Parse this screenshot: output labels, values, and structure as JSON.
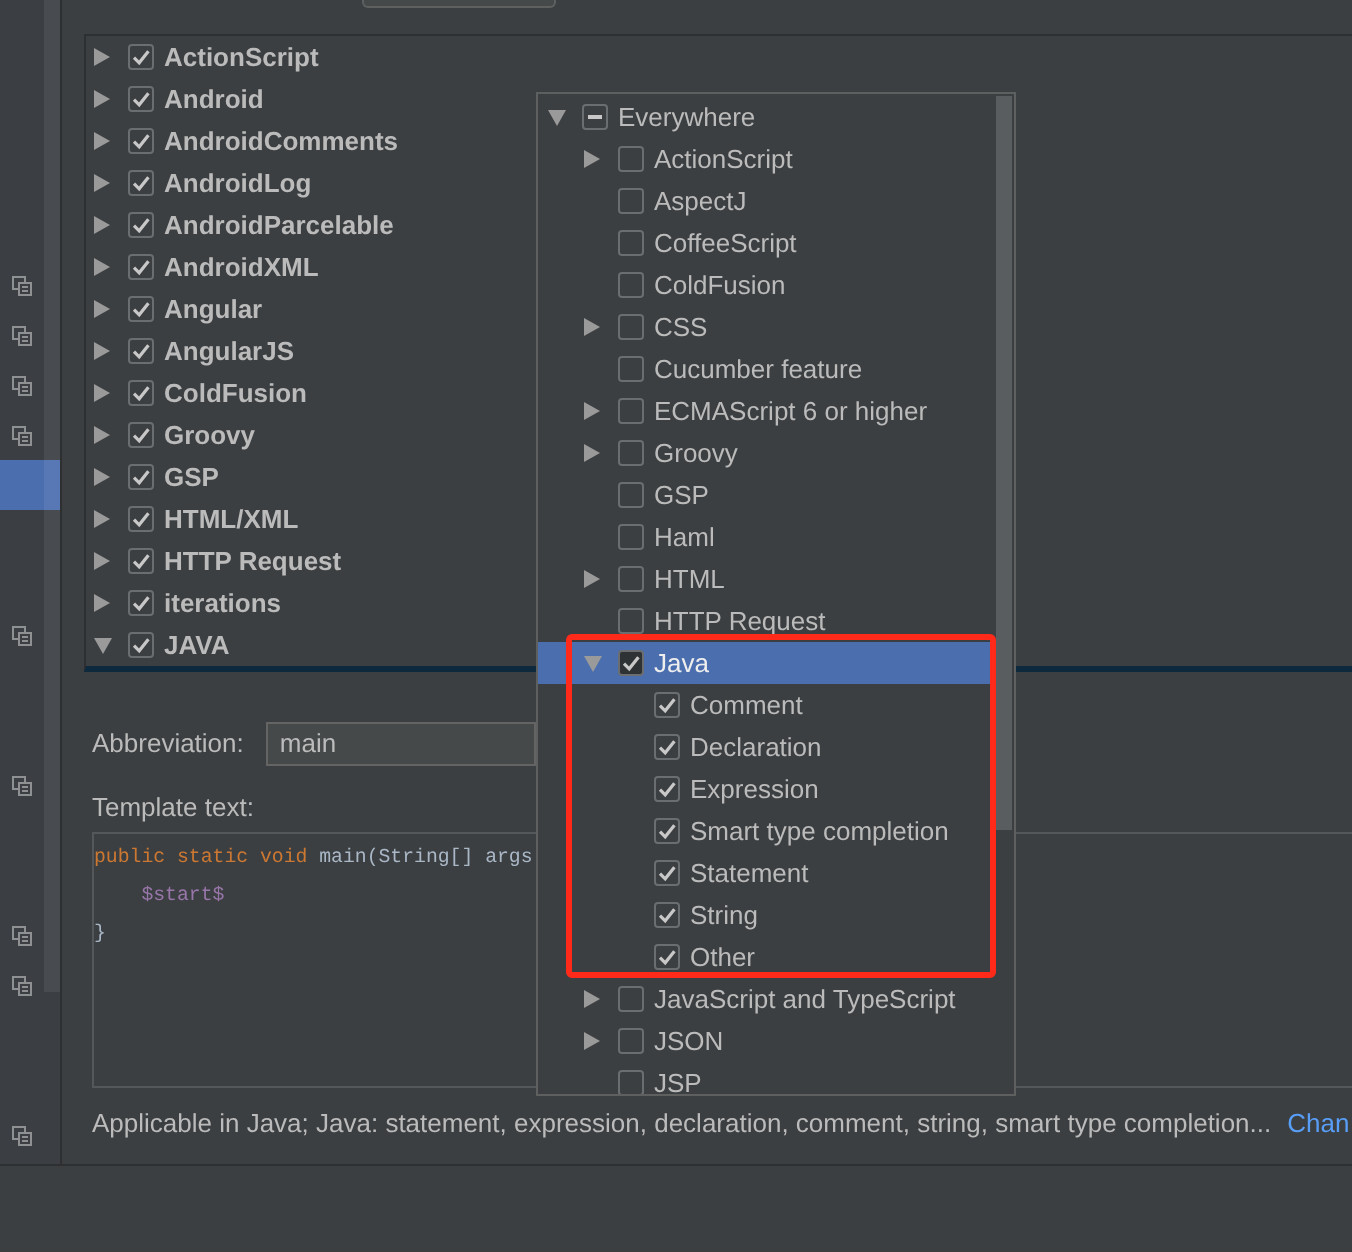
{
  "sidebar": {
    "rows": [
      {
        "icon": true,
        "selected": false
      },
      {
        "icon": true,
        "selected": false
      },
      {
        "icon": true,
        "selected": false
      },
      {
        "icon": true,
        "selected": false
      },
      {
        "icon": false,
        "selected": true
      },
      {
        "icon": false,
        "selected": false
      },
      {
        "icon": false,
        "selected": false
      },
      {
        "icon": true,
        "selected": false
      },
      {
        "icon": false,
        "selected": false
      },
      {
        "icon": false,
        "selected": false
      },
      {
        "icon": true,
        "selected": false
      },
      {
        "icon": false,
        "selected": false
      },
      {
        "icon": false,
        "selected": false
      },
      {
        "icon": true,
        "selected": false
      },
      {
        "icon": true,
        "selected": false
      },
      {
        "icon": false,
        "selected": false
      },
      {
        "icon": false,
        "selected": false
      },
      {
        "icon": true,
        "selected": false
      }
    ]
  },
  "templates": [
    {
      "label": "ActionScript",
      "checked": true,
      "expanded": false
    },
    {
      "label": "Android",
      "checked": true,
      "expanded": false
    },
    {
      "label": "AndroidComments",
      "checked": true,
      "expanded": false
    },
    {
      "label": "AndroidLog",
      "checked": true,
      "expanded": false
    },
    {
      "label": "AndroidParcelable",
      "checked": true,
      "expanded": false
    },
    {
      "label": "AndroidXML",
      "checked": true,
      "expanded": false
    },
    {
      "label": "Angular",
      "checked": true,
      "expanded": false
    },
    {
      "label": "AngularJS",
      "checked": true,
      "expanded": false
    },
    {
      "label": "ColdFusion",
      "checked": true,
      "expanded": false
    },
    {
      "label": "Groovy",
      "checked": true,
      "expanded": false
    },
    {
      "label": "GSP",
      "checked": true,
      "expanded": false
    },
    {
      "label": "HTML/XML",
      "checked": true,
      "expanded": false
    },
    {
      "label": "HTTP Request",
      "checked": true,
      "expanded": false
    },
    {
      "label": "iterations",
      "checked": true,
      "expanded": false
    },
    {
      "label": "JAVA",
      "checked": true,
      "expanded": true
    }
  ],
  "abbreviation": {
    "label": "Abbreviation:",
    "value": "main"
  },
  "template_text": {
    "label": "Template text:",
    "lines": [
      {
        "indented": false,
        "tokens": [
          {
            "text": "public",
            "kind": "keyword"
          },
          {
            "text": "static",
            "kind": "keyword"
          },
          {
            "text": "void",
            "kind": "keyword"
          },
          {
            "text": "main(String[] args",
            "kind": "plain"
          }
        ]
      },
      {
        "indented": true,
        "tokens": [
          {
            "text": "$start$",
            "kind": "variable"
          }
        ]
      },
      {
        "indented": false,
        "tokens": [
          {
            "text": "}",
            "kind": "plain"
          }
        ]
      }
    ]
  },
  "applicable": {
    "text": "Applicable in Java; Java: statement, expression, declaration, comment, string, smart type completion...",
    "link": "Chan"
  },
  "popup": {
    "items": [
      {
        "label": "Everywhere",
        "indeterminate": true,
        "expanded": true,
        "selected": false,
        "children": [
          {
            "label": "ActionScript",
            "checked": false,
            "expanded": false,
            "selected": false,
            "outlined": false
          },
          {
            "label": "AspectJ",
            "checked": false,
            "selected": false,
            "outlined": false
          },
          {
            "label": "CoffeeScript",
            "checked": false,
            "selected": false,
            "outlined": false
          },
          {
            "label": "ColdFusion",
            "checked": false,
            "selected": false,
            "outlined": false
          },
          {
            "label": "CSS",
            "checked": false,
            "expanded": false,
            "selected": false,
            "outlined": false
          },
          {
            "label": "Cucumber feature",
            "checked": false,
            "selected": false,
            "outlined": false
          },
          {
            "label": "ECMAScript 6 or higher",
            "checked": false,
            "expanded": false,
            "selected": false,
            "outlined": false
          },
          {
            "label": "Groovy",
            "checked": false,
            "expanded": false,
            "selected": false,
            "outlined": false
          },
          {
            "label": "GSP",
            "checked": false,
            "selected": false,
            "outlined": false
          },
          {
            "label": "Haml",
            "checked": false,
            "selected": false,
            "outlined": false
          },
          {
            "label": "HTML",
            "checked": false,
            "expanded": false,
            "selected": false,
            "outlined": false
          },
          {
            "label": "HTTP Request",
            "checked": false,
            "selected": false,
            "outlined": false
          },
          {
            "label": "Java",
            "checked": true,
            "expanded": true,
            "selected": true,
            "outlined": true,
            "children": [
              {
                "label": "Comment",
                "checked": true,
                "selected": false
              },
              {
                "label": "Declaration",
                "checked": true,
                "selected": false
              },
              {
                "label": "Expression",
                "checked": true,
                "selected": false
              },
              {
                "label": "Smart type completion",
                "checked": true,
                "selected": false
              },
              {
                "label": "Statement",
                "checked": true,
                "selected": false
              },
              {
                "label": "String",
                "checked": true,
                "selected": false
              },
              {
                "label": "Other",
                "checked": true,
                "selected": false
              }
            ]
          },
          {
            "label": "JavaScript and TypeScript",
            "checked": false,
            "expanded": false,
            "selected": false,
            "outlined": false
          },
          {
            "label": "JSON",
            "checked": false,
            "expanded": false,
            "selected": false,
            "outlined": false
          },
          {
            "label": "JSP",
            "checked": false,
            "selected": false,
            "outlined": false
          }
        ]
      }
    ]
  }
}
